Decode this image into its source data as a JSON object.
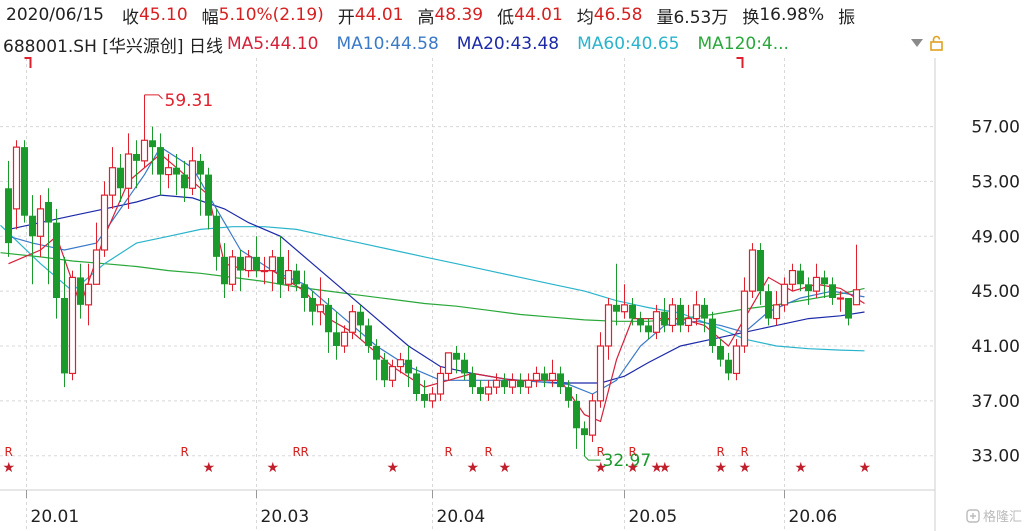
{
  "header": {
    "date": "2020/06/15",
    "close_label": "收",
    "close": "45.10",
    "change_label": "幅",
    "change": "5.10%(2.19)",
    "open_label": "开",
    "open": "44.01",
    "high_label": "高",
    "high": "48.39",
    "low_label": "低",
    "low": "44.01",
    "avg_label": "均",
    "avg": "46.58",
    "volume_label": "量",
    "volume": "6.53万",
    "turnover_label": "换",
    "turnover": "16.98%",
    "amplitude_label": "振"
  },
  "legend": {
    "ticker": "688001.SH [华兴源创] 日线",
    "ma5": "MA5:44.10",
    "ma10": "MA10:44.58",
    "ma20": "MA20:43.48",
    "ma60": "MA60:40.65",
    "ma120": "MA120:4..."
  },
  "colors": {
    "up": "#e0202c",
    "down": "#1a9a2a",
    "ma5": "#d6203a",
    "ma10": "#3a7ac8",
    "ma20": "#1c2aa8",
    "ma60": "#2ab4cc",
    "ma120": "#2aa83a",
    "grid": "#d8d8d8"
  },
  "icons": [
    "chevron-down-icon",
    "lock-icon"
  ],
  "watermark": "格隆汇",
  "chart_data": {
    "type": "candlestick",
    "ylim": [
      30.5,
      62
    ],
    "y_ticks": [
      "57.00",
      "53.00",
      "49.00",
      "45.00",
      "41.00",
      "37.00",
      "33.00"
    ],
    "x_ticks": [
      "20.01",
      "20.03",
      "20.04",
      "20.05",
      "20.06"
    ],
    "annotations": {
      "high": "59.31",
      "low": "32.97"
    },
    "markers": {
      "r": "R",
      "star": "★"
    },
    "candles": [
      [
        52.5,
        48.5,
        54.5,
        47.5
      ],
      [
        51,
        55.5,
        56,
        49.5
      ],
      [
        55.5,
        50.5,
        56,
        50
      ],
      [
        50.5,
        49,
        52,
        45.5
      ],
      [
        49,
        51,
        52,
        47.5
      ],
      [
        51.5,
        50,
        52.5,
        45.5
      ],
      [
        50,
        44.5,
        51,
        43
      ],
      [
        44.5,
        39,
        47.5,
        38
      ],
      [
        39,
        46,
        46.5,
        38.5
      ],
      [
        46,
        44,
        47,
        43
      ],
      [
        44,
        45.5,
        47,
        42.5
      ],
      [
        45.5,
        48,
        50,
        47
      ],
      [
        48,
        52,
        53,
        47.5
      ],
      [
        52,
        54,
        55.5,
        51
      ],
      [
        54,
        52.5,
        55,
        51.5
      ],
      [
        52.5,
        55,
        56.5,
        51
      ],
      [
        55,
        54.5,
        56,
        52.5
      ],
      [
        54.5,
        56,
        59.31,
        54
      ],
      [
        56,
        55.5,
        57,
        53.5
      ],
      [
        55.5,
        53.5,
        56.5,
        52
      ],
      [
        53.5,
        54,
        55,
        52.5
      ],
      [
        54,
        53.5,
        55,
        52
      ],
      [
        53.5,
        52.5,
        54.5,
        51.5
      ],
      [
        52.5,
        54.5,
        55.5,
        52
      ],
      [
        54.5,
        53.5,
        55,
        50.5
      ],
      [
        53.5,
        50.5,
        54,
        49.5
      ],
      [
        50.5,
        47.5,
        51,
        46.5
      ],
      [
        47.5,
        45.5,
        48.5,
        44.5
      ],
      [
        45.5,
        47.5,
        48,
        45
      ],
      [
        47.5,
        46.5,
        48,
        45
      ],
      [
        46.5,
        47.5,
        48,
        46
      ],
      [
        47.5,
        46.5,
        49,
        46
      ],
      [
        46.5,
        46.5,
        47.5,
        45.5
      ],
      [
        46.5,
        47.5,
        48,
        45
      ],
      [
        47.5,
        45.5,
        49,
        44.5
      ],
      [
        45.5,
        46.5,
        48,
        45
      ],
      [
        46.5,
        45.5,
        47,
        45
      ],
      [
        45.5,
        44.5,
        46.5,
        43.5
      ],
      [
        44.5,
        43.5,
        45,
        42.5
      ],
      [
        43.5,
        44,
        46,
        42.5
      ],
      [
        44,
        42,
        44.5,
        40.5
      ],
      [
        42,
        41,
        43.5,
        40
      ],
      [
        41,
        42,
        42.5,
        40.5
      ],
      [
        42,
        43.5,
        44,
        41.5
      ],
      [
        43.5,
        42.5,
        44,
        41.5
      ],
      [
        42.5,
        41,
        43,
        40.5
      ],
      [
        41,
        40,
        41.5,
        38.5
      ],
      [
        40,
        38.5,
        40.5,
        38
      ],
      [
        38.5,
        39.5,
        40,
        38
      ],
      [
        39.5,
        40,
        40.5,
        39
      ],
      [
        40,
        39,
        41,
        38
      ],
      [
        39,
        37.5,
        39.5,
        37
      ],
      [
        37.5,
        37,
        38.5,
        36.5
      ],
      [
        37,
        37.5,
        38,
        36.5
      ],
      [
        37.5,
        39,
        39.5,
        37
      ],
      [
        39,
        40.5,
        40.5,
        38.5
      ],
      [
        40.5,
        40,
        41,
        39
      ],
      [
        40,
        39,
        40.5,
        38.5
      ],
      [
        39,
        38,
        39.5,
        37.5
      ],
      [
        38,
        37.5,
        38.5,
        37
      ],
      [
        37.5,
        38,
        38.5,
        37
      ],
      [
        38,
        38.5,
        39,
        37.5
      ],
      [
        38.5,
        38,
        39,
        37.5
      ],
      [
        38,
        38.5,
        39,
        37.5
      ],
      [
        38.5,
        38,
        39,
        37.5
      ],
      [
        38,
        38.5,
        39,
        37.5
      ],
      [
        38.5,
        39,
        39.5,
        38
      ],
      [
        39,
        38.5,
        39.5,
        38
      ],
      [
        38.5,
        39,
        40,
        38
      ],
      [
        39,
        38,
        39.5,
        37.5
      ],
      [
        38,
        37,
        38.5,
        36.5
      ],
      [
        37,
        35,
        37.5,
        33.5
      ],
      [
        35,
        34.5,
        35.5,
        32.97
      ],
      [
        34.5,
        37,
        37.5,
        34
      ],
      [
        37,
        41,
        42,
        36.5
      ],
      [
        41,
        44,
        44.5,
        40
      ],
      [
        44,
        43.5,
        47,
        42.5
      ],
      [
        43.5,
        44,
        45.5,
        43
      ],
      [
        44,
        43,
        44.5,
        42.5
      ],
      [
        43,
        42.5,
        43.5,
        42
      ],
      [
        42.5,
        42,
        43,
        41.5
      ],
      [
        42,
        43.5,
        44,
        41.5
      ],
      [
        43.5,
        42.5,
        44.5,
        42
      ],
      [
        42.5,
        44,
        44.5,
        42
      ],
      [
        44,
        42.5,
        44.5,
        42
      ],
      [
        42.5,
        43,
        44,
        42
      ],
      [
        43,
        44,
        45,
        42.5
      ],
      [
        44,
        43,
        44.5,
        42
      ],
      [
        43,
        41,
        43.5,
        40.5
      ],
      [
        41,
        40,
        41.5,
        39.5
      ],
      [
        40,
        39,
        40.5,
        38.5
      ],
      [
        39,
        41,
        41.5,
        38.5
      ],
      [
        41,
        45,
        46,
        40.5
      ],
      [
        45,
        48,
        48.5,
        44.5
      ],
      [
        48,
        45,
        48.5,
        44
      ],
      [
        45,
        43,
        45.5,
        42.5
      ],
      [
        43,
        44,
        45,
        42.5
      ],
      [
        44,
        45.5,
        46,
        43.5
      ],
      [
        45.5,
        46.5,
        47,
        45
      ],
      [
        46.5,
        45.5,
        47,
        45
      ],
      [
        45.5,
        45,
        46,
        44
      ],
      [
        45,
        46,
        47,
        44.5
      ],
      [
        46,
        45.5,
        46.5,
        44.5
      ],
      [
        45.5,
        44.5,
        46,
        44
      ],
      [
        44.5,
        44.5,
        45,
        43.5
      ],
      [
        44.5,
        43,
        44.5,
        42.5
      ],
      [
        44.01,
        45.1,
        48.39,
        44.01
      ]
    ],
    "ma": {
      "MA5": [
        [
          0,
          47
        ],
        [
          4,
          48
        ],
        [
          6,
          49
        ],
        [
          9,
          44
        ],
        [
          12,
          49
        ],
        [
          15,
          53
        ],
        [
          19,
          55
        ],
        [
          21,
          54
        ],
        [
          25,
          52
        ],
        [
          27,
          47
        ],
        [
          30,
          46.5
        ],
        [
          33,
          46.5
        ],
        [
          37,
          45
        ],
        [
          40,
          43
        ],
        [
          43,
          42
        ],
        [
          46,
          40.5
        ],
        [
          48,
          39.5
        ],
        [
          52,
          38
        ],
        [
          55,
          38.5
        ],
        [
          58,
          39
        ],
        [
          63,
          38.5
        ],
        [
          69,
          38.5
        ],
        [
          72,
          36
        ],
        [
          74,
          35.5
        ],
        [
          76,
          40
        ],
        [
          78,
          43
        ],
        [
          81,
          43
        ],
        [
          84,
          43
        ],
        [
          87,
          42.5
        ],
        [
          90,
          41
        ],
        [
          93,
          44
        ],
        [
          95,
          46
        ],
        [
          98,
          45
        ],
        [
          101,
          45.5
        ],
        [
          104,
          45.2
        ],
        [
          107,
          44.1
        ]
      ],
      "MA10": [
        [
          0,
          49
        ],
        [
          3,
          48.5
        ],
        [
          7,
          48
        ],
        [
          11,
          48.5
        ],
        [
          14,
          51
        ],
        [
          17,
          53.5
        ],
        [
          19,
          55.5
        ],
        [
          23,
          54
        ],
        [
          26,
          51
        ],
        [
          29,
          48
        ],
        [
          33,
          46.5
        ],
        [
          37,
          45.5
        ],
        [
          40,
          44
        ],
        [
          43,
          42.5
        ],
        [
          46,
          41
        ],
        [
          50,
          39.5
        ],
        [
          54,
          38.5
        ],
        [
          58,
          38.5
        ],
        [
          64,
          38.5
        ],
        [
          70,
          38.2
        ],
        [
          73,
          37.5
        ],
        [
          76,
          38.5
        ],
        [
          79,
          41
        ],
        [
          82,
          42.5
        ],
        [
          86,
          42.8
        ],
        [
          89,
          42.5
        ],
        [
          92,
          42
        ],
        [
          95,
          43.5
        ],
        [
          99,
          44.5
        ],
        [
          103,
          45
        ],
        [
          107,
          44.58
        ]
      ],
      "MA20": [
        [
          0,
          49.5
        ],
        [
          4,
          50
        ],
        [
          8,
          50.5
        ],
        [
          12,
          51
        ],
        [
          16,
          51.5
        ],
        [
          19,
          52
        ],
        [
          23,
          51.8
        ],
        [
          27,
          51
        ],
        [
          30,
          50
        ],
        [
          34,
          49
        ],
        [
          38,
          47
        ],
        [
          42,
          45
        ],
        [
          46,
          43
        ],
        [
          50,
          41
        ],
        [
          54,
          39.5
        ],
        [
          58,
          39
        ],
        [
          62,
          38.6
        ],
        [
          66,
          38.4
        ],
        [
          70,
          38.3
        ],
        [
          74,
          38.3
        ],
        [
          77,
          38.8
        ],
        [
          80,
          39.8
        ],
        [
          84,
          41
        ],
        [
          88,
          41.5
        ],
        [
          92,
          42
        ],
        [
          96,
          42.5
        ],
        [
          100,
          43
        ],
        [
          104,
          43.2
        ],
        [
          107,
          43.48
        ]
      ],
      "MA60": [
        [
          -1,
          49.8
        ],
        [
          4,
          47
        ],
        [
          8,
          45
        ],
        [
          12,
          47
        ],
        [
          16,
          48.5
        ],
        [
          20,
          49
        ],
        [
          24,
          49.5
        ],
        [
          28,
          49.7
        ],
        [
          32,
          49.7
        ],
        [
          36,
          49.5
        ],
        [
          40,
          49
        ],
        [
          44,
          48.5
        ],
        [
          48,
          48
        ],
        [
          52,
          47.5
        ],
        [
          56,
          47
        ],
        [
          60,
          46.5
        ],
        [
          64,
          46
        ],
        [
          68,
          45.5
        ],
        [
          72,
          45
        ],
        [
          76,
          44.3
        ],
        [
          80,
          43.8
        ],
        [
          84,
          43.4
        ],
        [
          88,
          42.5
        ],
        [
          92,
          41.5
        ],
        [
          96,
          41
        ],
        [
          100,
          40.8
        ],
        [
          104,
          40.7
        ],
        [
          107,
          40.65
        ]
      ],
      "MA120": [
        [
          -1,
          47.8
        ],
        [
          4,
          47.5
        ],
        [
          8,
          47.2
        ],
        [
          12,
          47
        ],
        [
          16,
          46.8
        ],
        [
          20,
          46.5
        ],
        [
          24,
          46.3
        ],
        [
          28,
          46
        ],
        [
          32,
          45.7
        ],
        [
          36,
          45.3
        ],
        [
          40,
          45
        ],
        [
          44,
          44.7
        ],
        [
          48,
          44.4
        ],
        [
          52,
          44.1
        ],
        [
          56,
          43.9
        ],
        [
          60,
          43.6
        ],
        [
          64,
          43.3
        ],
        [
          68,
          43.1
        ],
        [
          72,
          42.9
        ],
        [
          76,
          42.8
        ],
        [
          80,
          42.8
        ],
        [
          84,
          43
        ],
        [
          88,
          43.3
        ],
        [
          92,
          43.7
        ],
        [
          96,
          44
        ],
        [
          100,
          44.4
        ],
        [
          104,
          44.8
        ],
        [
          107,
          45.2
        ]
      ]
    },
    "r_marks": [
      0,
      22,
      36,
      37,
      55,
      60,
      74,
      78,
      89,
      92
    ],
    "star_marks": [
      0,
      25,
      33,
      48,
      58,
      62,
      74,
      78,
      81,
      82,
      89,
      92,
      99,
      107
    ],
    "x_tick_index": [
      2,
      31,
      53,
      77,
      97
    ]
  }
}
